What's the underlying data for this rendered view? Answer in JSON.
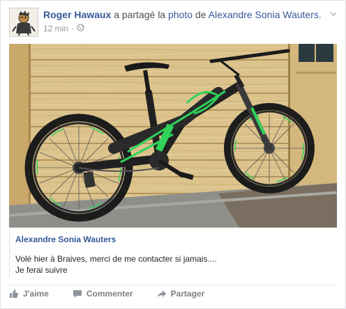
{
  "post": {
    "author": "Roger Hawaux",
    "shared_text": "a partagé la",
    "photo_word": "photo",
    "de_text": "de",
    "original_author": "Alexandre Sonia Wauters",
    "period": ".",
    "time": "12 min",
    "separator": "·"
  },
  "attachment": {
    "title": "Alexandre Sonia Wauters",
    "line1": "Volé hier à Braives, merci de me contacter si jamais....",
    "line2": "Je ferai suivre"
  },
  "actions": {
    "like": "J'aime",
    "comment": "Commenter",
    "share": "Partager"
  },
  "colors": {
    "link": "#365899",
    "meta": "#90949c",
    "bike_green": "#2fd35a"
  },
  "icons": [
    "globe-icon",
    "chevron-down-icon",
    "like-icon",
    "comment-icon",
    "share-icon"
  ]
}
